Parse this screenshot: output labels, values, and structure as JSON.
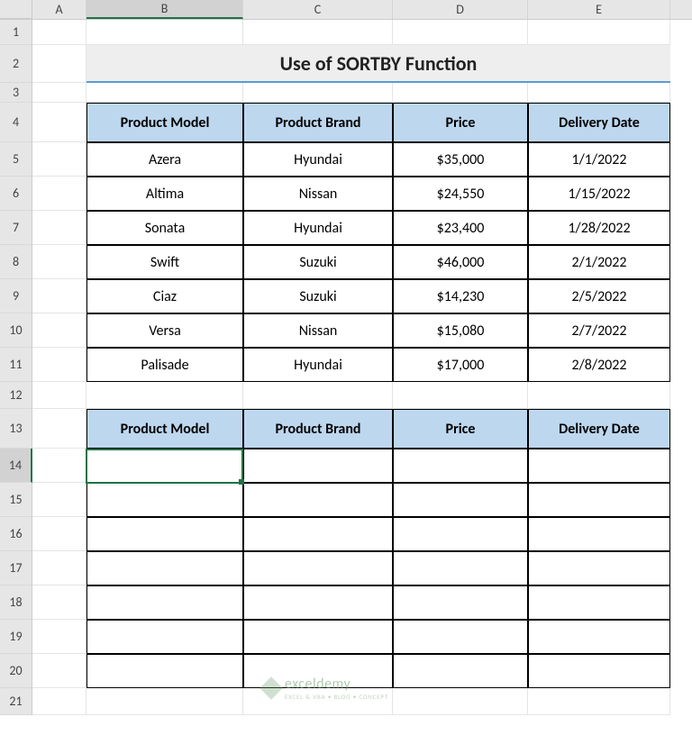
{
  "columns": [
    "A",
    "B",
    "C",
    "D",
    "E"
  ],
  "row_numbers": [
    1,
    2,
    3,
    4,
    5,
    6,
    7,
    8,
    9,
    10,
    11,
    12,
    13,
    14,
    15,
    16,
    17,
    18,
    19,
    20,
    21
  ],
  "title": "Use of SORTBY Function",
  "table1": {
    "headers": [
      "Product Model",
      "Product Brand",
      "Price",
      "Delivery Date"
    ],
    "rows": [
      {
        "model": "Azera",
        "brand": "Hyundai",
        "price": "$35,000",
        "date": "1/1/2022"
      },
      {
        "model": "Altima",
        "brand": "Nissan",
        "price": "$24,550",
        "date": "1/15/2022"
      },
      {
        "model": "Sonata",
        "brand": "Hyundai",
        "price": "$23,400",
        "date": "1/28/2022"
      },
      {
        "model": "Swift",
        "brand": "Suzuki",
        "price": "$46,000",
        "date": "2/1/2022"
      },
      {
        "model": "Ciaz",
        "brand": "Suzuki",
        "price": "$14,230",
        "date": "2/5/2022"
      },
      {
        "model": "Versa",
        "brand": "Nissan",
        "price": "$15,080",
        "date": "2/7/2022"
      },
      {
        "model": "Palisade",
        "brand": "Hyundai",
        "price": "$17,000",
        "date": "2/8/2022"
      }
    ]
  },
  "table2": {
    "headers": [
      "Product Model",
      "Product Brand",
      "Price",
      "Delivery Date"
    ],
    "row_count": 7
  },
  "selected_cell": "B14",
  "watermark": {
    "name": "exceldemy",
    "tagline": "EXCEL & VBA • BLOG • CONCEPT"
  }
}
